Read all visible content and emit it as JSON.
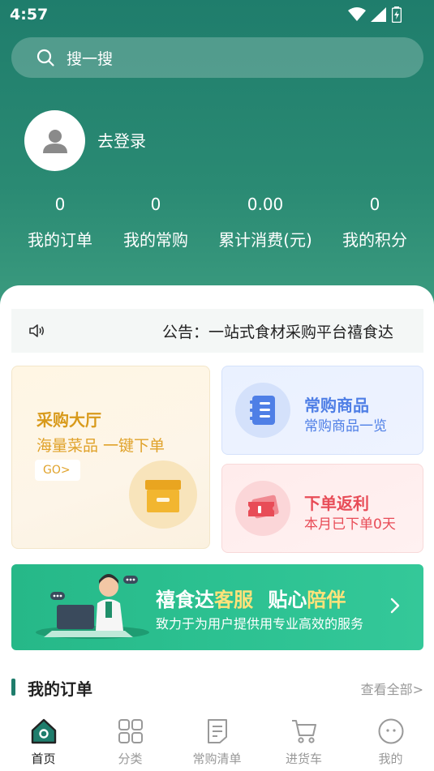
{
  "status_bar": {
    "time": "4:57"
  },
  "search": {
    "placeholder": "搜一搜"
  },
  "profile": {
    "login_label": "去登录"
  },
  "stats": [
    {
      "value": "0",
      "label": "我的订单"
    },
    {
      "value": "0",
      "label": "我的常购"
    },
    {
      "value": "0.00",
      "label": "累计消费(元)"
    },
    {
      "value": "0",
      "label": "我的积分"
    }
  ],
  "notice": {
    "text": "公告：一站式食材采购平台禧食达"
  },
  "purchase_hall": {
    "title": "采购大厅",
    "subtitle": "海量菜品 一键下单",
    "go_label": "GO>"
  },
  "regular_goods": {
    "title": "常购商品",
    "subtitle": "常购商品一览"
  },
  "order_rebate": {
    "title": "下单返利",
    "subtitle": "本月已下单0天"
  },
  "service_banner": {
    "title_a": "禧食达",
    "title_b": "客服",
    "title_c": "贴心",
    "title_d": "陪伴",
    "subtitle": "致力于为用户提供用专业高效的服务"
  },
  "orders_section": {
    "title": "我的订单",
    "more_label": "查看全部>"
  },
  "tabbar": [
    {
      "label": "首页",
      "icon": "home-icon"
    },
    {
      "label": "分类",
      "icon": "grid-icon"
    },
    {
      "label": "常购清单",
      "icon": "list-icon"
    },
    {
      "label": "进货车",
      "icon": "cart-icon"
    },
    {
      "label": "我的",
      "icon": "profile-icon"
    }
  ],
  "colors": {
    "header": "#1f7d6c",
    "accent_orange": "#d89a1b",
    "accent_blue": "#4f7fe6",
    "accent_red": "#e84c57",
    "banner_green": "#2cc191"
  }
}
